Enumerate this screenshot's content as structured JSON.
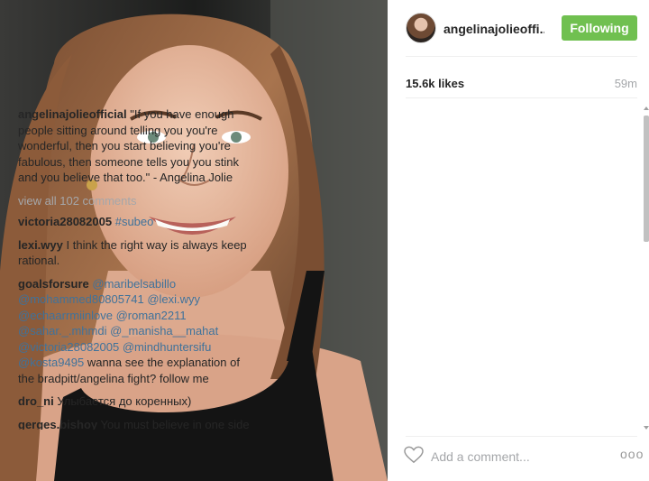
{
  "post": {
    "photo_alt": "portrait photo",
    "header": {
      "username": "angelinajolieoffi...",
      "follow_label": "Following",
      "follow_color": "#70c050"
    },
    "likes": "15.6k likes",
    "time_ago": "59m",
    "caption": {
      "username": "angelinajolieofficial",
      "text": "\"If you have enough people sitting around telling you you're wonderful, then you start believing you're fabulous, then someone tells you you stink and you believe that too.\" - Angelina Jolie"
    },
    "view_all_label": "view all 102 comments",
    "comments": [
      {
        "username": "victoria28082005",
        "parts": [
          {
            "type": "tag",
            "text": "#subeo"
          }
        ]
      },
      {
        "username": "lexi.wyy",
        "parts": [
          {
            "type": "text",
            "text": "I think the right way is always keep rational."
          }
        ]
      },
      {
        "username": "goalsforsure",
        "parts": [
          {
            "type": "tag",
            "text": "@maribelsabillo"
          },
          {
            "type": "tag",
            "text": "@mohammed80805741"
          },
          {
            "type": "tag",
            "text": "@lexi.wyy"
          },
          {
            "type": "tag",
            "text": "@echaarrmiinlove"
          },
          {
            "type": "tag",
            "text": "@roman2211"
          },
          {
            "type": "tag",
            "text": "@sahar._.mhmdi"
          },
          {
            "type": "tag",
            "text": "@_manisha__mahat"
          },
          {
            "type": "tag",
            "text": "@victoria28082005"
          },
          {
            "type": "tag",
            "text": "@mindhuntersifu"
          },
          {
            "type": "tag",
            "text": "@kosta9495"
          },
          {
            "type": "text",
            "text": "wanna see the explanation of the bradpitt/angelina fight? follow me"
          }
        ]
      },
      {
        "username": "dro_ni",
        "parts": [
          {
            "type": "text",
            "text": "Улыбается до коренных)"
          }
        ]
      },
      {
        "username": "gerges.bishoy",
        "parts": [
          {
            "type": "text",
            "text": "You must believe in one side that stills for ever with you this is"
          }
        ]
      }
    ],
    "footer": {
      "comment_placeholder": "Add a comment...",
      "more_label": "ooo",
      "heart_icon": "heart-icon"
    },
    "colors": {
      "link": "#3f729b",
      "muted": "#a5a7aa"
    }
  }
}
